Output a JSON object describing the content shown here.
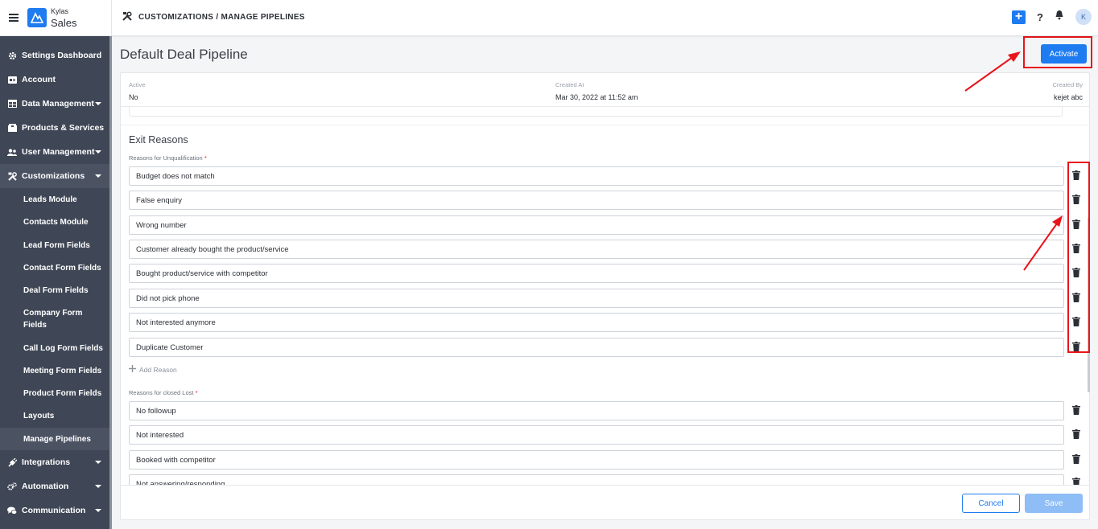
{
  "app": {
    "brand_small": "Kylas",
    "brand_big": "Sales"
  },
  "header": {
    "breadcrumb": "CUSTOMIZATIONS / MANAGE PIPELINES",
    "avatar_initial": "K",
    "help": "?"
  },
  "sidebar": {
    "items": [
      {
        "label": "Settings Dashboard",
        "icon": "gear-icon"
      },
      {
        "label": "Account",
        "icon": "id-card-icon"
      },
      {
        "label": "Data Management",
        "icon": "table-icon",
        "caret": true
      },
      {
        "label": "Products & Services",
        "icon": "box-icon"
      },
      {
        "label": "User Management",
        "icon": "users-icon",
        "caret": true
      },
      {
        "label": "Customizations",
        "icon": "tools-icon",
        "caret": true,
        "open": true
      }
    ],
    "sub_items": [
      "Leads Module",
      "Contacts Module",
      "Lead Form Fields",
      "Contact Form Fields",
      "Deal Form Fields",
      "Company Form Fields",
      "Call Log Form Fields",
      "Meeting Form Fields",
      "Product Form Fields",
      "Layouts",
      "Manage Pipelines"
    ],
    "active_sub": "Manage Pipelines",
    "bottom_items": [
      {
        "label": "Integrations",
        "icon": "plug-icon"
      },
      {
        "label": "Automation",
        "icon": "cogs-icon"
      },
      {
        "label": "Communication",
        "icon": "chat-icon"
      }
    ]
  },
  "page": {
    "title": "Default Deal Pipeline",
    "activate_label": "Activate",
    "info": {
      "active_label": "Active",
      "active_value": "No",
      "created_at_label": "Created At",
      "created_at_value": "Mar 30, 2022 at 11:52 am",
      "created_by_label": "Created By",
      "created_by_value": "kejet abc"
    },
    "exit_reasons": {
      "title": "Exit Reasons",
      "unqualification_label": "Reasons for Unqualification",
      "unqualification": [
        "Budget does not match",
        "False enquiry",
        "Wrong number",
        "Customer already bought the product/service",
        "Bought product/service with competitor",
        "Did not pick phone",
        "Not interested anymore",
        "Duplicate Customer"
      ],
      "add_reason": "Add Reason",
      "closed_lost_label": "Reasons for closed Lost",
      "closed_lost": [
        "No followup",
        "Not interested",
        "Booked with competitor",
        "Not answering/responding"
      ]
    },
    "footer": {
      "cancel": "Cancel",
      "save": "Save"
    }
  },
  "colors": {
    "accent": "#1e7bf0",
    "sidebar": "#3f4756",
    "annotation": "#e8151b"
  }
}
